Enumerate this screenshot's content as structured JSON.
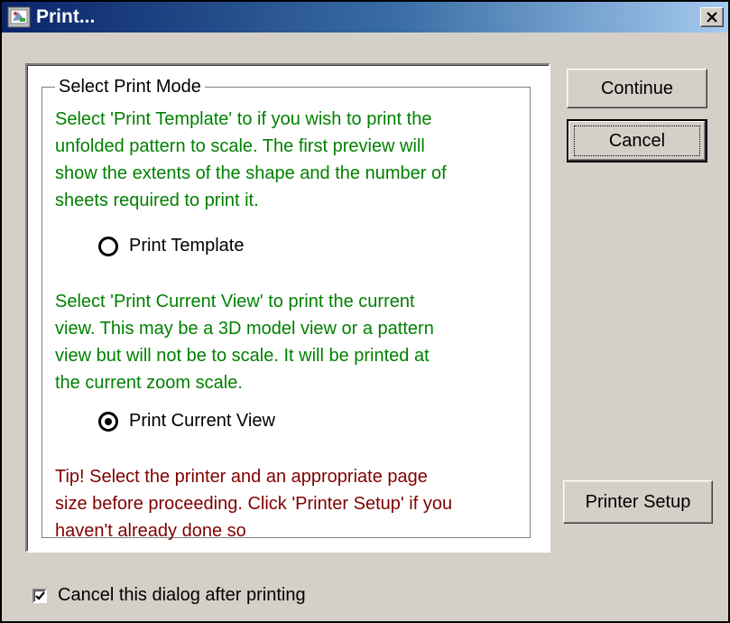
{
  "window": {
    "title": "Print...",
    "icon": "print-app-icon",
    "close_icon": "close-icon",
    "colors": {
      "face": "#d4d0c8",
      "title_start": "#0a246a",
      "title_end": "#a6caf0",
      "info_text": "#008000",
      "tip_text": "#800000"
    }
  },
  "group": {
    "legend": "Select Print Mode",
    "template_description": [
      "Select 'Print Template' to if you wish to print the",
      "unfolded pattern to scale. The first preview will",
      "show the extents of the shape and the number of",
      "sheets required to print it."
    ],
    "template_option": {
      "label": "Print Template",
      "selected": false
    },
    "current_view_description": [
      "Select 'Print Current View' to print the current",
      "view.  This may be a 3D model view or a pattern",
      "view but will not be to scale. It will be printed at",
      "the current zoom scale."
    ],
    "current_view_option": {
      "label": "Print Current View",
      "selected": true
    },
    "tip": [
      "Tip! Select the printer and an appropriate page",
      "size before proceeding. Click 'Printer Setup' if you",
      "haven't already done so"
    ]
  },
  "buttons": {
    "continue": "Continue",
    "cancel": "Cancel",
    "printer_setup": "Printer Setup"
  },
  "footer": {
    "checkbox_label": "Cancel this dialog after printing",
    "checked": true
  }
}
